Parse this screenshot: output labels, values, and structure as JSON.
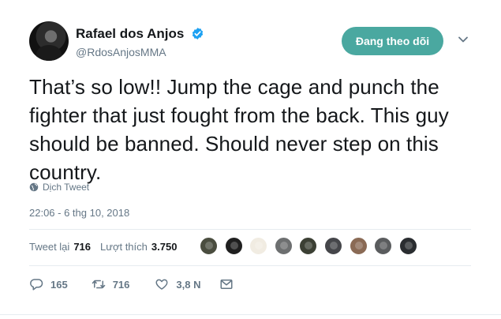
{
  "author": {
    "name": "Rafael dos Anjos",
    "handle": "@RdosAnjosMMA",
    "verified": true
  },
  "follow_button": {
    "label": "Đang theo dõi",
    "color": "#4aa8a0"
  },
  "tweet": {
    "text": "That’s so low!! Jump the cage and punch the fighter that just fought from the back. This guy should be banned. Should never step on this country.",
    "translate_label": "Dịch Tweet",
    "timestamp": "22:06 - 6 thg 10, 2018"
  },
  "stats": {
    "retweets_label": "Tweet lại",
    "retweets_value": "716",
    "likes_label": "Lượt thích",
    "likes_value": "3.750"
  },
  "likers": [
    {
      "color": "#4a4d3f"
    },
    {
      "color": "#1f1f1f"
    },
    {
      "color": "#f1ece2"
    },
    {
      "color": "#6d6f70"
    },
    {
      "color": "#3c4034"
    },
    {
      "color": "#45464a"
    },
    {
      "color": "#8a6a55"
    },
    {
      "color": "#5a5c5e"
    },
    {
      "color": "#2a2d30"
    }
  ],
  "actions": {
    "reply_count": "165",
    "retweet_count": "716",
    "like_count": "3,8 N"
  },
  "icons": [
    "verified-badge-icon",
    "chevron-down-icon",
    "globe-icon",
    "reply-icon",
    "retweet-icon",
    "heart-icon",
    "mail-icon"
  ]
}
